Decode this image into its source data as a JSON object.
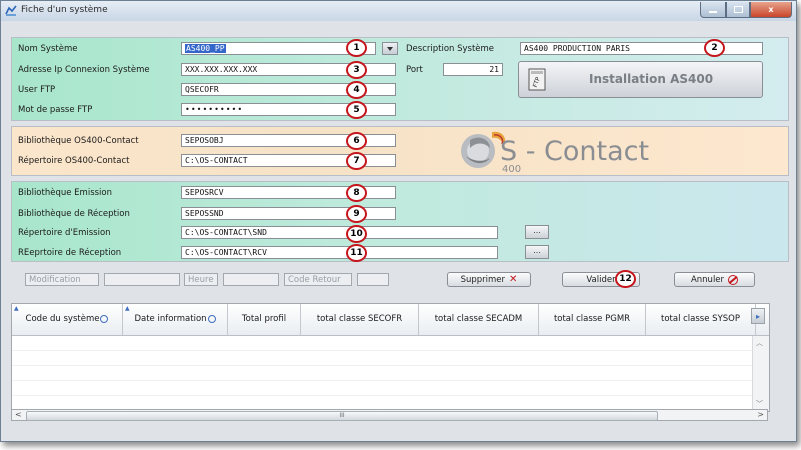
{
  "window": {
    "title": "Fiche d'un système",
    "controls": {
      "minimize": "",
      "maximize": "",
      "close": "x"
    }
  },
  "system": {
    "nom_label": "Nom Système",
    "nom_value": "AS400_PP",
    "description_label": "Description Système",
    "description_value": "AS400 PRODUCTION PARIS",
    "ip_label": "Adresse Ip Connexion Système",
    "ip_value": "XXX.XXX.XXX.XXX",
    "port_label": "Port",
    "port_value": "21",
    "user_label": "User FTP",
    "user_value": "QSECOFR",
    "password_label": "Mot de passe FTP",
    "password_value": "••••••••••",
    "install_button": "Installation AS400",
    "install_icon": "ftp-server-icon"
  },
  "oscontact": {
    "bib_label": "Bibliothèque OS400-Contact",
    "bib_value": "SEPOSOBJ",
    "rep_label": "Répertoire OS400-Contact",
    "rep_value": "C:\\OS-CONTACT",
    "logo_text": "S - Contact",
    "logo_sub": "400"
  },
  "transfer": {
    "bib_emission_label": "Bibliothèque Emission",
    "bib_emission_value": "SEPOSRCV",
    "bib_reception_label": "Bibliothèque de Réception",
    "bib_reception_value": "SEPOSSND",
    "rep_emission_label": "Répertoire d'Emission",
    "rep_emission_value": "C:\\OS-CONTACT\\SND",
    "rep_reception_label": "REeprtoire de Réception",
    "rep_reception_value": "C:\\OS-CONTACT\\RCV",
    "browse": "..."
  },
  "status": {
    "modification_label": "Modification",
    "heure_label": "Heure",
    "code_retour_label": "Code Retour"
  },
  "actions": {
    "supprimer": "Supprimer",
    "valider": "Valider",
    "annuler": "Annuler"
  },
  "markers": [
    "1",
    "2",
    "3",
    "4",
    "5",
    "6",
    "7",
    "8",
    "9",
    "10",
    "11",
    "12"
  ],
  "grid": {
    "columns": [
      "Code du système",
      "Date information",
      "Total profil",
      "total classe SECOFR",
      "total classe SECADM",
      "total classe PGMR",
      "total classe SYSOP"
    ],
    "rows": [],
    "scroll_label": "III"
  },
  "colors": {
    "accent_green": "#a8e6cc",
    "accent_peach": "#fbe6cc",
    "marker_red": "#c4161c",
    "selection_blue": "#3467c9"
  }
}
